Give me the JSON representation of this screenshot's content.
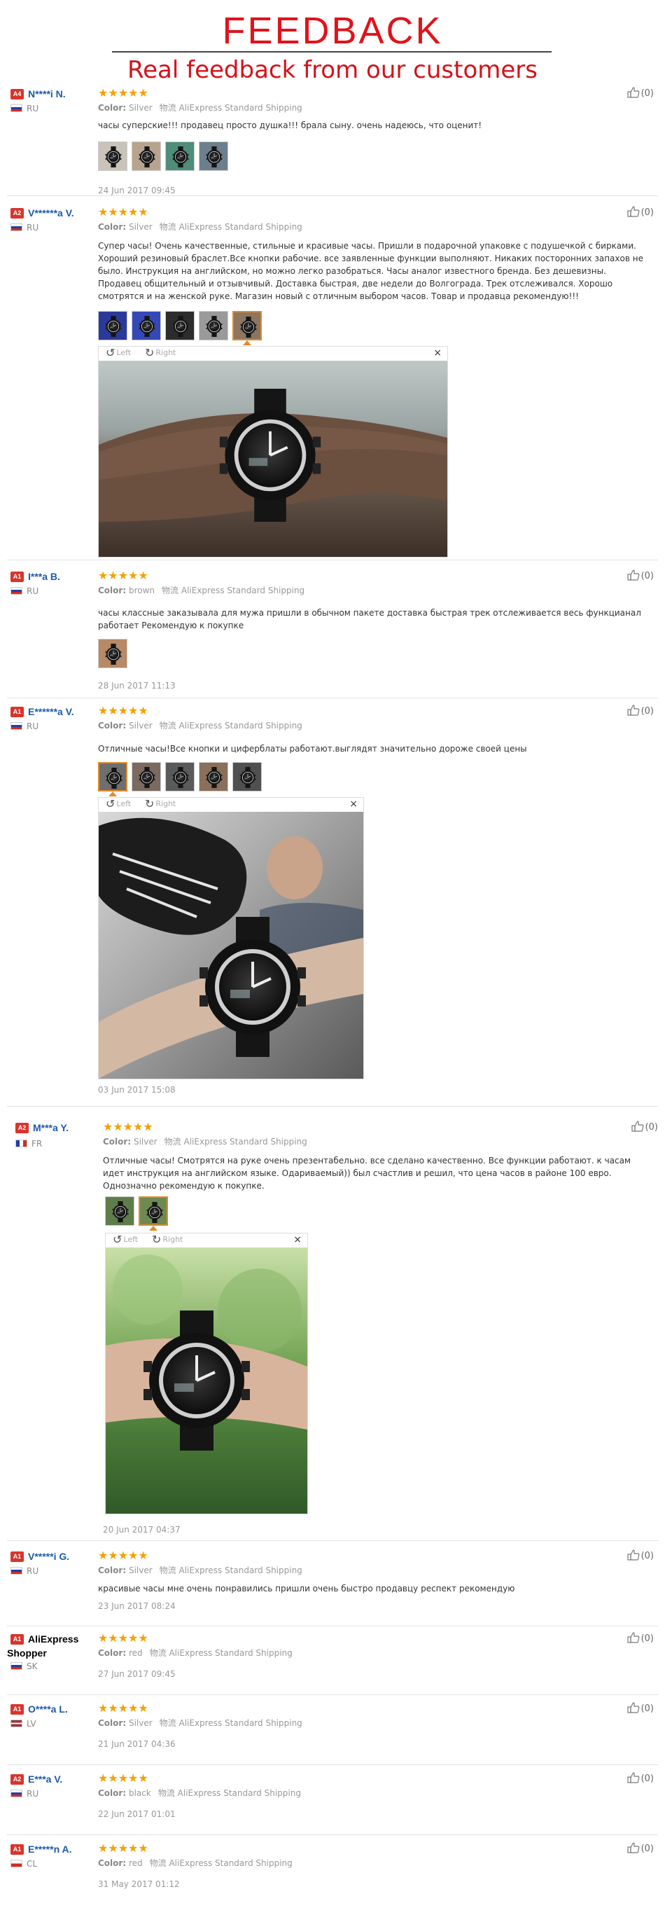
{
  "header": {
    "title": "FEEDBACK",
    "subtitle": "Real feedback from our customers"
  },
  "labels": {
    "color": "Color:",
    "shipping_method": "物流",
    "shipping": "AliExpress Standard Shipping",
    "rotate_left": "Left",
    "rotate_right": "Right",
    "close": "×"
  },
  "reviews": [
    {
      "badge": "A4",
      "name": "N****i N.",
      "country": "RU",
      "stars": "★★★★★",
      "color": "Silver",
      "text": "часы суперские!!! продавец просто душка!!! брала сыну. очень надеюсь, что оценит!",
      "date": "24 Jun 2017 09:45",
      "helpful": "(0)"
    },
    {
      "badge": "A2",
      "name": "V******a V.",
      "country": "RU",
      "stars": "★★★★★",
      "color": "Silver",
      "text": "Супер часы! Очень качественные, стильные и красивые часы. Пришли в подарочной упаковке с подушечкой с бирками. Хороший резиновый браслет.Все кнопки рабочие. все заявленные функции выполняют. Никаких посторонних запахов не было. Инструкция на английском, но можно легко разобраться. Часы аналог известного бренда. Без дешевизны. Продавец общительный и отзывчивый. Доставка быстрая, две недели до Волгограда. Трек отслеживался. Хорошо смотрятся и на женской руке. Магазин новый с отличным выбором часов. Товар и продавца рекомендую!!!",
      "date": "",
      "helpful": "(0)"
    },
    {
      "badge": "A1",
      "name": "I***a B.",
      "country": "RU",
      "stars": "★★★★★",
      "color": "brown",
      "text": "часы классные заказывала для мужа пришли в обычном пакете доставка быстрая трек отслеживается весь функцианал работает Рекомендую к покупке",
      "date": "28 Jun 2017 11:13",
      "helpful": "(0)"
    },
    {
      "badge": "A1",
      "name": "E******a V.",
      "country": "RU",
      "stars": "★★★★★",
      "color": "Silver",
      "text": "Отличные часы!Все кнопки и циферблаты работают.выглядят значительно дороже своей цены",
      "date": "03 Jun 2017 15:08",
      "helpful": "(0)"
    },
    {
      "badge": "A2",
      "name": "M***a Y.",
      "country": "FR",
      "stars": "★★★★★",
      "color": "Silver",
      "text": "Отличные часы! Смотрятся на руке очень презентабельно. все сделано качественно. Все функции работают. к часам идет инструкция на английском языке. Одариваемый)) был счастлив и решил, что цена часов в районе 100 евро. Однозначно рекомендую к покупке.",
      "date": "20 Jun 2017 04:37",
      "helpful": "(0)"
    },
    {
      "badge": "A1",
      "name": "V*****i G.",
      "country": "RU",
      "stars": "★★★★★",
      "color": "Silver",
      "text": "красивые часы мне очень понравились пришли очень быстро продавцу респект рекомендую",
      "date": "23 Jun 2017 08:24",
      "helpful": "(0)"
    },
    {
      "badge": "A1",
      "name": "AliExpress Shopper",
      "country": "SK",
      "stars": "★★★★★",
      "color": "red",
      "text": "",
      "date": "27 Jun 2017 09:45",
      "helpful": "(0)"
    },
    {
      "badge": "A1",
      "name": "O****a L.",
      "country": "LV",
      "stars": "★★★★★",
      "color": "Silver",
      "text": "",
      "date": "21 Jun 2017 04:36",
      "helpful": "(0)"
    },
    {
      "badge": "A2",
      "name": "E***a V.",
      "country": "RU",
      "stars": "★★★★★",
      "color": "black",
      "text": "",
      "date": "22 Jun 2017 01:01",
      "helpful": "(0)"
    },
    {
      "badge": "A1",
      "name": "E*****n A.",
      "country": "CL",
      "stars": "★★★★★",
      "color": "red",
      "text": "",
      "date": "31 May 2017 01:12",
      "helpful": "(0)"
    }
  ],
  "colors": {
    "title_red": "#e0131b",
    "star": "#f5a000",
    "name_blue": "#1d5aa8",
    "badge_red": "#d9342b"
  }
}
